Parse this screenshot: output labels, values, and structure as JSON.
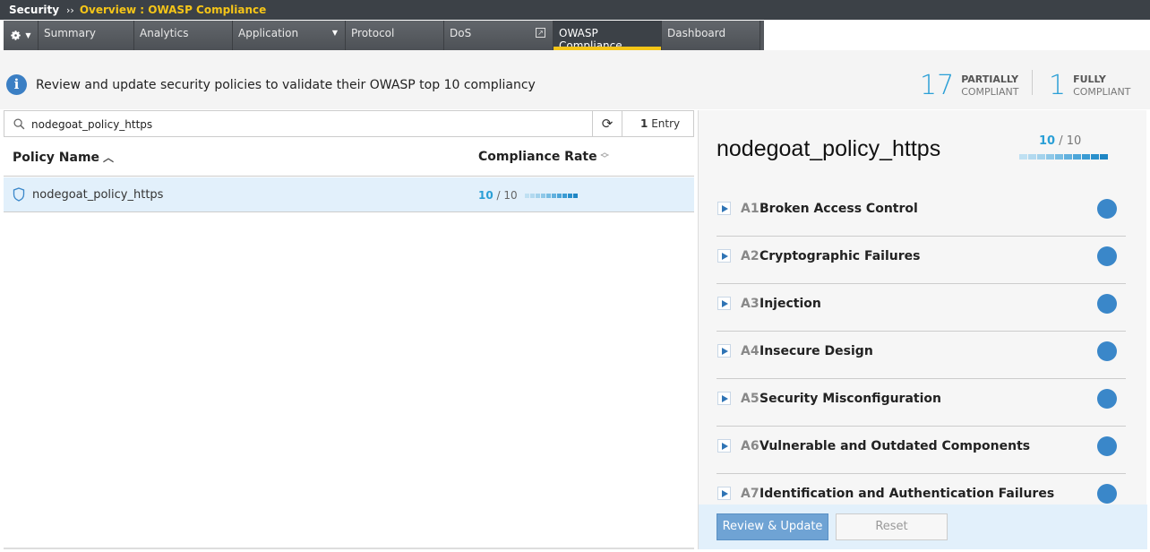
{
  "breadcrumb": {
    "root": "Security",
    "separator": "››",
    "current": "Overview : OWASP Compliance"
  },
  "tabs": [
    {
      "label": "Summary"
    },
    {
      "label": "Analytics"
    },
    {
      "label": "Application"
    },
    {
      "label": "Protocol"
    },
    {
      "label": "DoS"
    },
    {
      "label": "OWASP Compliance"
    },
    {
      "label": "Dashboard"
    }
  ],
  "info": {
    "text": "Review and update security policies to validate their OWASP top 10 compliancy",
    "icon": "info-icon"
  },
  "stats": {
    "partial_count": "17",
    "partial_label_1": "PARTIALLY",
    "partial_label_2": "COMPLIANT",
    "full_count": "1",
    "full_label_1": "FULLY",
    "full_label_2": "COMPLIANT"
  },
  "search": {
    "value": "nodegoat_policy_https",
    "entry_count": "1",
    "entry_label": "Entry"
  },
  "table": {
    "columns": [
      "Policy Name",
      "Compliance Rate"
    ],
    "rows": [
      {
        "name": "nodegoat_policy_https",
        "score": "10",
        "total": "/ 10"
      }
    ]
  },
  "detail": {
    "policy_name": "nodegoat_policy_https",
    "score": "10",
    "total": "/ 10",
    "categories": [
      {
        "code": "A1",
        "title": "Broken Access Control"
      },
      {
        "code": "A2",
        "title": "Cryptographic Failures"
      },
      {
        "code": "A3",
        "title": "Injection"
      },
      {
        "code": "A4",
        "title": "Insecure Design"
      },
      {
        "code": "A5",
        "title": "Security Misconfiguration"
      },
      {
        "code": "A6",
        "title": "Vulnerable and Outdated Components"
      },
      {
        "code": "A7",
        "title": "Identification and Authentication Failures"
      }
    ],
    "review_label": "Review & Update",
    "reset_label": "Reset"
  },
  "colors": {
    "accent": "#2a9fd6",
    "tab_active_underline": "#f5c518",
    "status_dot": "#3a87c9"
  }
}
